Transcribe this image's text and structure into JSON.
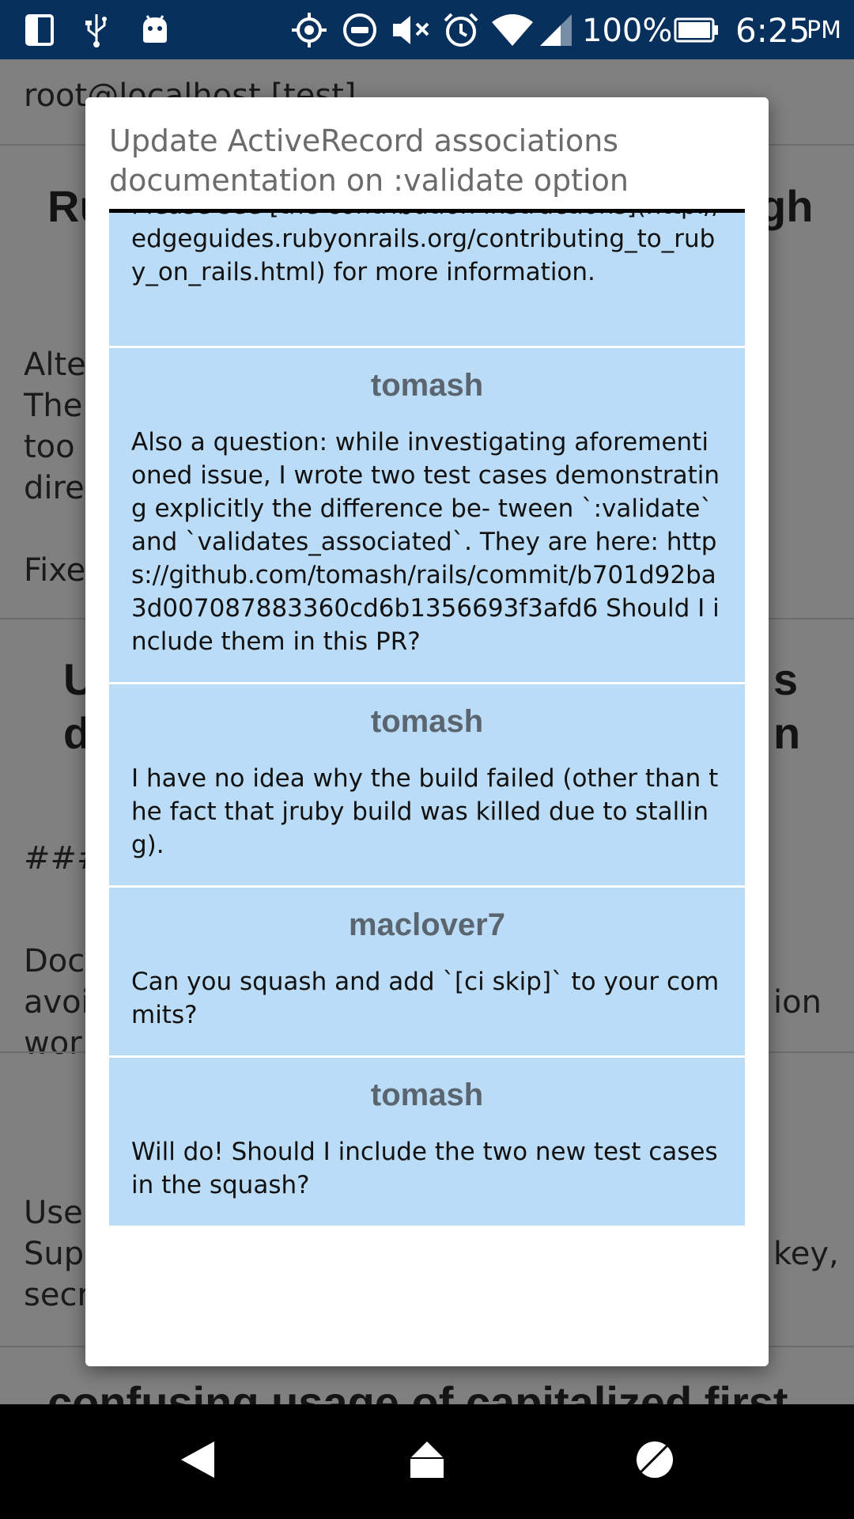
{
  "status_bar": {
    "battery_percent": "100%",
    "time": "6:25",
    "ampm": "PM",
    "icons": [
      "screen-icon",
      "usb-icon",
      "android-icon",
      "gps-icon",
      "dnd-icon",
      "mute-icon",
      "alarm-icon",
      "wifi-icon",
      "signal-icon",
      "battery-icon"
    ]
  },
  "background": {
    "user_host": "root@localhost [test]",
    "frag_title1": "Ru",
    "frag_title1_right": "gh",
    "frag_lines1": [
      "Alte",
      "The",
      "too",
      "dire"
    ],
    "frag_fixe": "Fixe",
    "frag_title2a": "U",
    "frag_title2a_right": "s",
    "frag_title2b": "d",
    "frag_title2b_right": "n",
    "frag_hash": "###",
    "frag_lines2": [
      "Doc",
      "avoi",
      "wor"
    ],
    "frag_lines2_right": "ion",
    "frag_lines3": [
      "Use",
      "Sup",
      "secr"
    ],
    "frag_lines3_right": "key,",
    "frag_bottom": "confusing usage of capitalized first"
  },
  "dialog": {
    "title": "Update ActiveRecord associations documentation on :validate option",
    "comments": [
      {
        "author": "",
        "body": "Please see [the contribution instructions](http://edgeguides.rubyonrails.org/contributing_to_ruby_on_rails.html) for more information."
      },
      {
        "author": "tomash",
        "body": "Also a question: while investigating aforementioned issue, I wrote two test cases demonstrating explicitly the difference be- tween `:validate` and `validates_associated`. They are here: https://github.com/tomash/rails/commit/b701d92ba3d007087883360cd6b1356693f3afd6 Should I include them in this PR?"
      },
      {
        "author": "tomash",
        "body": "I have no idea why the build failed (other than the fact that jruby build was killed due to stalling)."
      },
      {
        "author": "maclover7",
        "body": "Can you squash and add `[ci skip]` to your commits?"
      },
      {
        "author": "tomash",
        "body": "Will do! Should I include the two new test cases in the squash?"
      }
    ]
  },
  "nav": {
    "buttons": [
      "back-icon",
      "home-icon",
      "recents-icon"
    ]
  }
}
